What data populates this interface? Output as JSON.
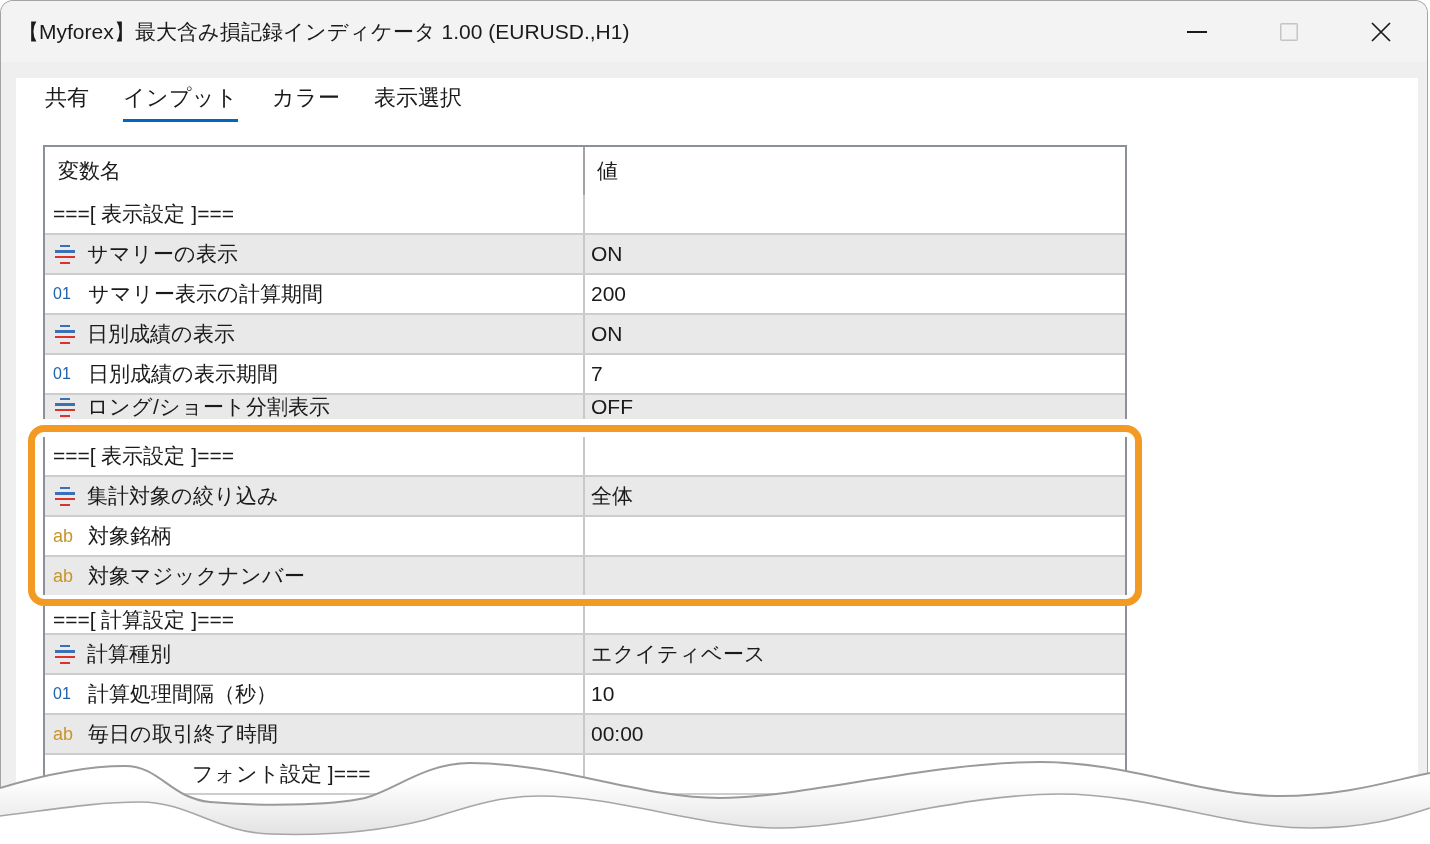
{
  "window": {
    "title": "【Myforex】最大含み損記録インディケータ 1.00 (EURUSD.,H1)",
    "controls": [
      {
        "kind": "minimize",
        "disabled": false
      },
      {
        "kind": "maximize",
        "disabled": true
      },
      {
        "kind": "close",
        "disabled": false
      }
    ]
  },
  "tabs": [
    {
      "label": "共有",
      "selected": false
    },
    {
      "label": "インプット",
      "selected": true
    },
    {
      "label": "カラー",
      "selected": false
    },
    {
      "label": "表示選択",
      "selected": false
    }
  ],
  "table": {
    "columns": [
      "変数名",
      "値"
    ],
    "sections": [
      {
        "highlighted": false,
        "rows": [
          {
            "kind": "separator",
            "name": "===[ 表示設定 ]==="
          },
          {
            "kind": "enum",
            "name": "サマリーの表示",
            "value": "ON"
          },
          {
            "kind": "int",
            "type_code": "01",
            "name": "サマリー表示の計算期間",
            "value": "200"
          },
          {
            "kind": "enum",
            "name": "日別成績の表示",
            "value": "ON"
          },
          {
            "kind": "int",
            "type_code": "01",
            "name": "日別成績の表示期間",
            "value": "7"
          },
          {
            "kind": "enum",
            "name": "ロング/ショート分割表示",
            "value": "OFF"
          }
        ]
      },
      {
        "highlighted": true,
        "rows": [
          {
            "kind": "separator",
            "name": "===[ 表示設定 ]==="
          },
          {
            "kind": "enum",
            "name": "集計対象の絞り込み",
            "value": "全体"
          },
          {
            "kind": "string",
            "type_code": "ab",
            "name": "対象銘柄"
          },
          {
            "kind": "string",
            "type_code": "ab",
            "name": "対象マジックナンバー"
          }
        ]
      },
      {
        "highlighted": false,
        "rows": [
          {
            "kind": "separator",
            "name": "===[ 計算設定 ]==="
          },
          {
            "kind": "enum",
            "name": "計算種別",
            "value": "エクイティベース"
          },
          {
            "kind": "int",
            "type_code": "01",
            "name": "計算処理間隔（秒）",
            "value": "10"
          },
          {
            "kind": "string",
            "type_code": "ab",
            "name": "毎日の取引終了時間",
            "value": "00:00"
          },
          {
            "kind": "separator",
            "name": "フォント設定 ]==="
          }
        ]
      }
    ]
  }
}
